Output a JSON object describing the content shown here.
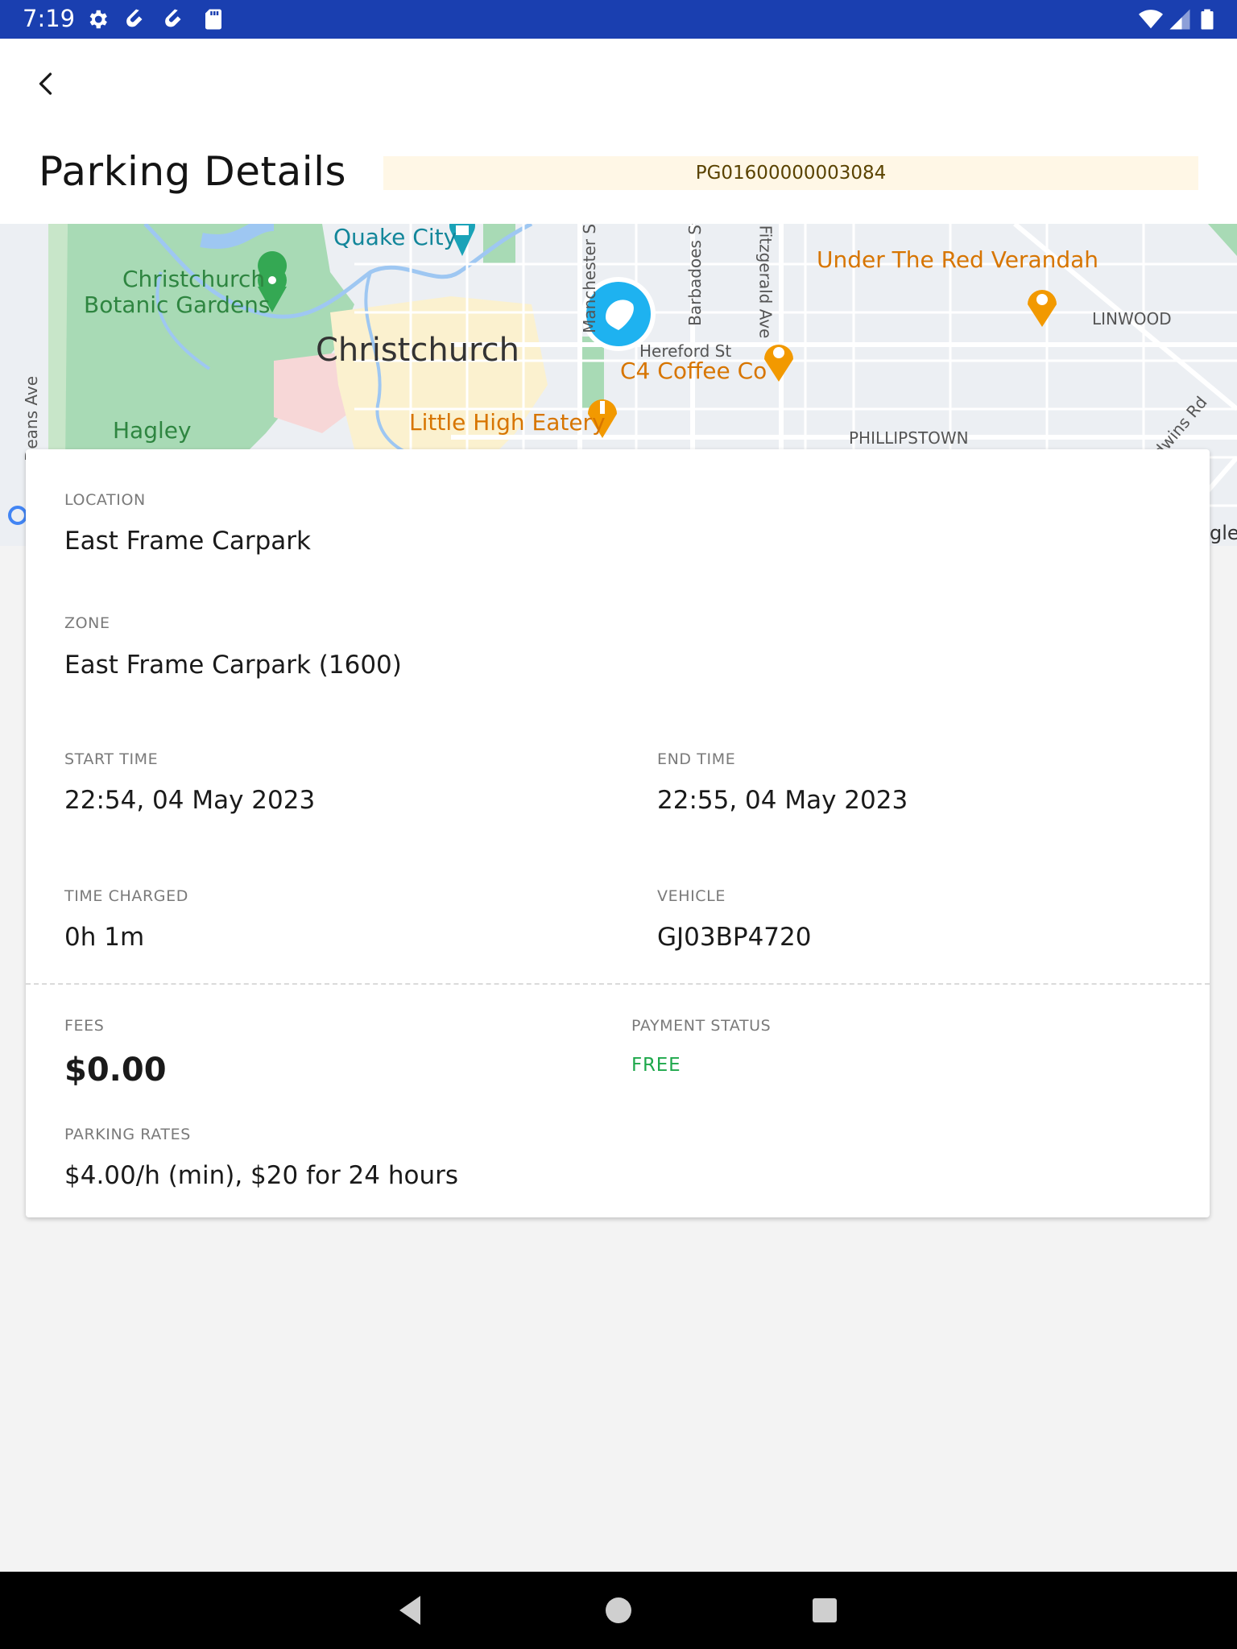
{
  "status_bar": {
    "time": "7:19",
    "left_icons": [
      "gear-icon",
      "app-icon",
      "app-icon",
      "sd-card-icon"
    ],
    "right_icons": [
      "wifi-icon",
      "signal-icon",
      "battery-icon"
    ]
  },
  "header": {
    "title": "Parking Details",
    "reference": "PG01600000003084",
    "back_icon": "chevron-left-icon"
  },
  "map": {
    "labels": {
      "quake_city": "Quake City",
      "botanic_1": "Christchurch",
      "botanic_2": "Botanic Gardens",
      "city": "Christchurch",
      "hagley": "Hagley",
      "deans_ave": "Deans Ave",
      "manchester_st": "Manchester St",
      "barbadoes_st": "Barbadoes St",
      "fitzgerald_ave": "Fitzgerald Ave",
      "under_red_verandah": "Under The Red Verandah",
      "linwood": "LINWOOD",
      "hereford_st": "Hereford St",
      "c4_coffee": "C4 Coffee Co",
      "little_high": "Little High Eatery",
      "phillipstown": "PHILLIPSTOWN",
      "baldwins_rd": "dwins Rd",
      "google_partial": "gle"
    },
    "colors": {
      "park": "#a8dab5",
      "water": "#9ec7f2",
      "road": "#ffffff",
      "poi_orange": "#e8830c",
      "poi_teal": "#1aa3b8",
      "marker": "#1eb2f0"
    }
  },
  "details": {
    "location_label": "LOCATION",
    "location_value": "East Frame Carpark",
    "zone_label": "ZONE",
    "zone_value": "East Frame Carpark (1600)",
    "start_label": "START TIME",
    "start_value": "22:54, 04 May 2023",
    "end_label": "END TIME",
    "end_value": "22:55, 04 May 2023",
    "charged_label": "TIME CHARGED",
    "charged_value": "0h 1m",
    "vehicle_label": "VEHICLE",
    "vehicle_value": "GJ03BP4720",
    "fees_label": "FEES",
    "fees_value": "$0.00",
    "payment_label": "PAYMENT STATUS",
    "payment_value": "FREE",
    "rates_label": "PARKING RATES",
    "rates_value": "$4.00/h (min), $20 for 24 hours"
  },
  "colors": {
    "status_bar": "#1a3fb0",
    "badge_bg": "#fff7e6",
    "free_green": "#1ea84b"
  },
  "nav_bar": {
    "icons": [
      "back-triangle-icon",
      "home-circle-icon",
      "recents-square-icon"
    ]
  }
}
